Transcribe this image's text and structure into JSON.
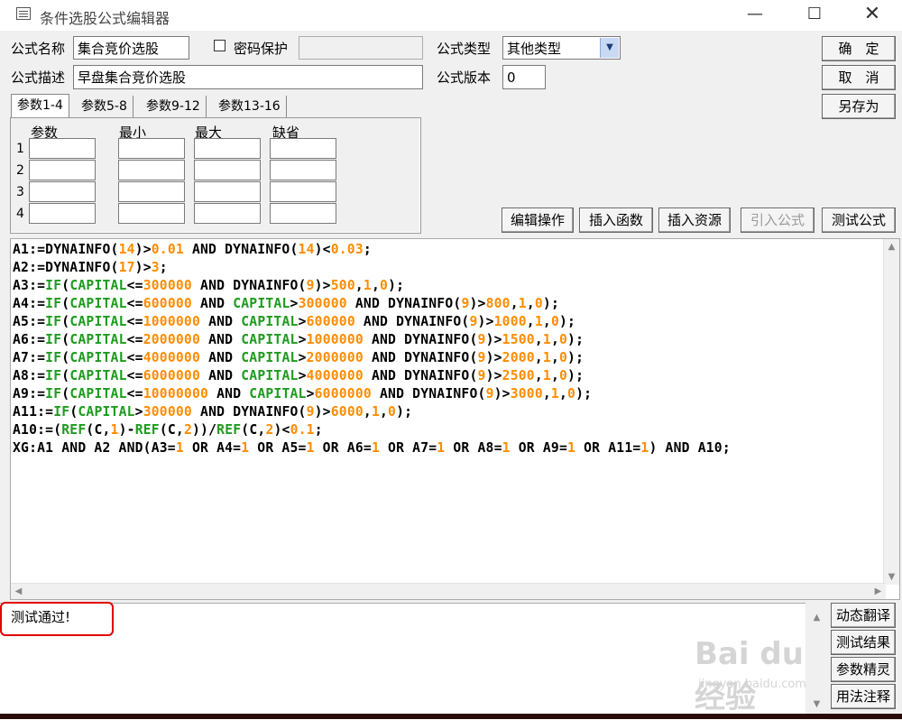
{
  "window": {
    "title": "条件选股公式编辑器",
    "min": "—",
    "max": "☐",
    "close": "✕"
  },
  "form": {
    "name_label": "公式名称",
    "name_value": "集合竞价选股",
    "password_label": "密码保护",
    "password_checked": false,
    "type_label": "公式类型",
    "type_value": "其他类型",
    "desc_label": "公式描述",
    "desc_value": "早盘集合竞价选股",
    "version_label": "公式版本",
    "version_value": "0"
  },
  "buttons": {
    "ok": "确　定",
    "cancel": "取　消",
    "save_as": "另存为",
    "edit_ops": "编辑操作",
    "insert_func": "插入函数",
    "insert_res": "插入资源",
    "import_formula": "引入公式",
    "test_formula": "测试公式"
  },
  "tabs": [
    "参数1-4",
    "参数5-8",
    "参数9-12",
    "参数13-16"
  ],
  "params": {
    "headers": [
      "参数",
      "最小",
      "最大",
      "缺省"
    ],
    "rows": [
      "1",
      "2",
      "3",
      "4"
    ]
  },
  "code_lines": [
    "A1:=DYNAINFO(14)>0.01 AND DYNAINFO(14)<0.03;",
    "A2:=DYNAINFO(17)>3;",
    "A3:=IF(CAPITAL<=300000 AND DYNAINFO(9)>500,1,0);",
    "A4:=IF(CAPITAL<=600000 AND CAPITAL>300000 AND DYNAINFO(9)>800,1,0);",
    "A5:=IF(CAPITAL<=1000000 AND CAPITAL>600000 AND DYNAINFO(9)>1000,1,0);",
    "A6:=IF(CAPITAL<=2000000 AND CAPITAL>1000000 AND DYNAINFO(9)>1500,1,0);",
    "A7:=IF(CAPITAL<=4000000 AND CAPITAL>2000000 AND DYNAINFO(9)>2000,1,0);",
    "A8:=IF(CAPITAL<=6000000 AND CAPITAL>4000000 AND DYNAINFO(9)>2500,1,0);",
    "A9:=IF(CAPITAL<=10000000 AND CAPITAL>6000000 AND DYNAINFO(9)>3000,1,0);",
    "A11:=IF(CAPITAL>300000 AND DYNAINFO(9)>6000,1,0);",
    "A10:=(REF(C,1)-REF(C,2))/REF(C,2)<0.1;",
    "XG:A1 AND A2 AND(A3=1 OR A4=1 OR A5=1 OR A6=1 OR A7=1 OR A8=1 OR A9=1 OR A11=1) AND A10;"
  ],
  "output": {
    "text": "测试通过!"
  },
  "side_buttons": [
    "动态翻译",
    "测试结果",
    "参数精灵",
    "用法注释"
  ],
  "watermark": {
    "brand": "Bai du 经验",
    "url": "jingyan.baidu.com"
  },
  "colors": {
    "number": "#ff8c00",
    "keyword": "#1e9b1e",
    "highlight": "#e10000",
    "select_arrow": "#c9d9f3"
  }
}
